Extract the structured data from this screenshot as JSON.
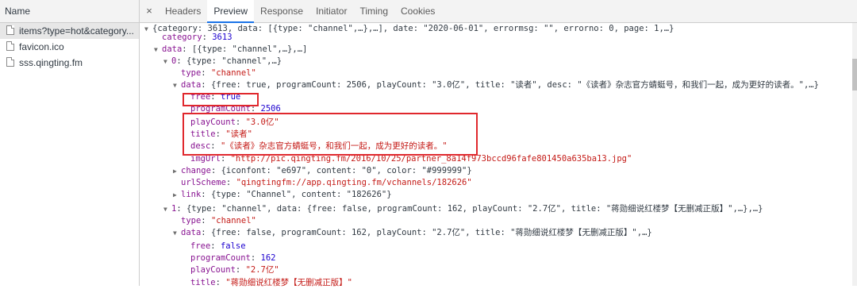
{
  "sidebar": {
    "header": "Name",
    "requests": [
      "items?type=hot&category...",
      "favicon.ico",
      "sss.qingting.fm"
    ]
  },
  "tabs": {
    "close": "×",
    "items": [
      "Headers",
      "Preview",
      "Response",
      "Initiator",
      "Timing",
      "Cookies"
    ],
    "active": "Preview"
  },
  "preview": {
    "l1": "{category: 3613, data: [{type: \"channel\",…},…], date: \"2020-06-01\", errormsg: \"\", errorno: 0, page: 1,…}",
    "l2_key": "category",
    "l2_val": "3613",
    "l3_key": "data",
    "l3_val": "[{type: \"channel\",…},…]",
    "l4_key": "0",
    "l4_val": "{type: \"channel\",…}",
    "l5_key": "type",
    "l5_val": "\"channel\"",
    "l6_key": "data",
    "l6_val": "{free: true, programCount: 2506, playCount: \"3.0亿\", title: \"读者\", desc: \"《读者》杂志官方蜻蜓号，和我们一起，成为更好的读者。\",…}",
    "l7_key": "free",
    "l7_val": "true",
    "l8_key": "programCount",
    "l8_val": "2506",
    "l9_key": "playCount",
    "l9_val": "\"3.0亿\"",
    "l10_key": "title",
    "l10_val": "\"读者\"",
    "l11_key": "desc",
    "l11_val": "\"《读者》杂志官方蜻蜓号，和我们一起，成为更好的读者。\"",
    "l12_key": "imgUrl",
    "l12_val": "\"http://pic.qingting.fm/2016/10/25/partner_8a14f973bccd96fafe801450a635ba13.jpg\"",
    "l13_key": "change",
    "l13_val": "{iconfont: \"e697\", content: \"0\", color: \"#999999\"}",
    "l14_key": "urlScheme",
    "l14_val": "\"qingtingfm://app.qingting.fm/vchannels/182626\"",
    "l15_key": "link",
    "l15_val": "{type: \"Channel\", content: \"182626\"}",
    "l16_key": "1",
    "l16_val": "{type: \"channel\", data: {free: false, programCount: 162, playCount: \"2.7亿\", title: \"蒋勋细说红楼梦【无删减正版】\",…},…}",
    "l17_key": "type",
    "l17_val": "\"channel\"",
    "l18_key": "data",
    "l18_val": "{free: false, programCount: 162, playCount: \"2.7亿\", title: \"蒋勋细说红楼梦【无删减正版】\",…}",
    "l19_key": "free",
    "l19_val": "false",
    "l20_key": "programCount",
    "l20_val": "162",
    "l21_key": "playCount",
    "l21_val": "\"2.7亿\"",
    "l22_key": "title",
    "l22_val": "\"蒋勋细说红楼梦【无删减正版】\"",
    "sep": ": "
  },
  "colors": {
    "highlight_box": "#e0282d",
    "active_tab_underline": "#1a73e8"
  }
}
